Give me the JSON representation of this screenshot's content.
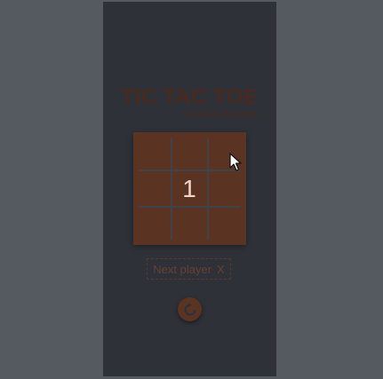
{
  "game": {
    "title": "TIC TAC TOE",
    "credit": "Created by: Soundboy",
    "board": [
      "",
      "",
      "",
      "",
      "1",
      "",
      "",
      "",
      ""
    ],
    "next_label": "Next player",
    "next_player": "X"
  },
  "icons": {
    "reset": "restart-icon",
    "pointer": "mouse-pointer-icon"
  },
  "colors": {
    "background": "#555a61",
    "panel": "#2e3138",
    "board": "#5a3322",
    "grid_lines": "#40434b",
    "accent_text": "#4a2a1e",
    "cell_text": "#f0d6c8"
  }
}
